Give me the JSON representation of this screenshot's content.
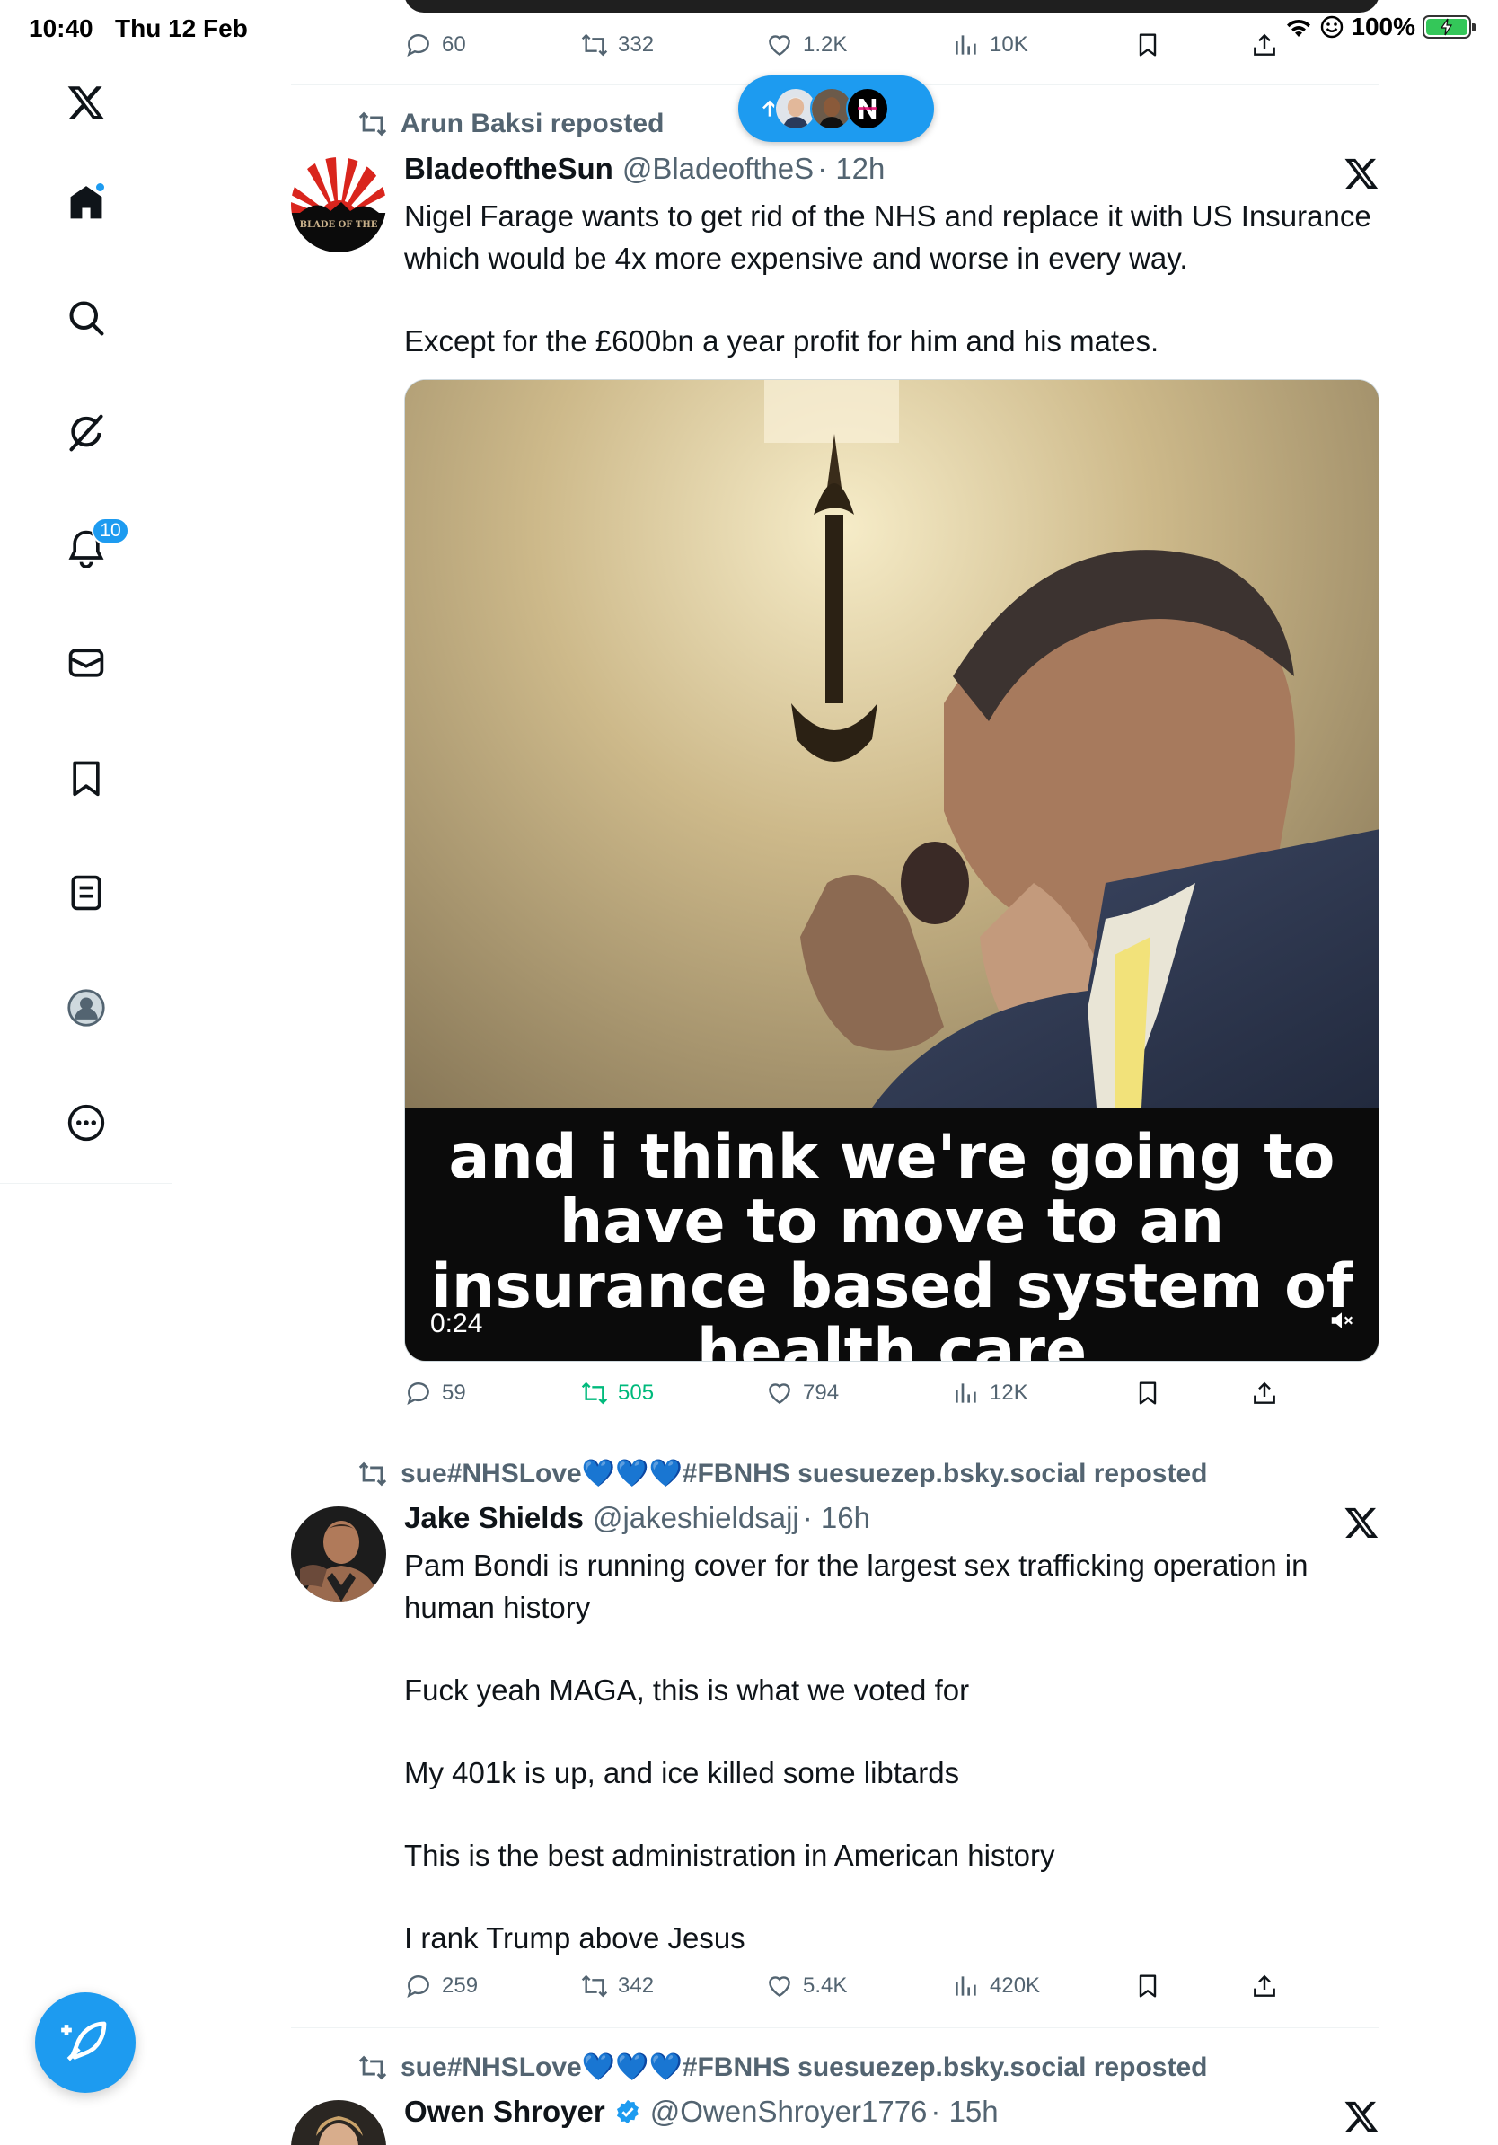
{
  "status_bar": {
    "time": "10:40",
    "date": "Thu 12 Feb",
    "battery": "100%"
  },
  "sidebar": {
    "items": [
      {
        "name": "home"
      },
      {
        "name": "explore"
      },
      {
        "name": "grok"
      },
      {
        "name": "notifications",
        "badge": "10"
      },
      {
        "name": "messages"
      },
      {
        "name": "bookmarks"
      },
      {
        "name": "lists"
      },
      {
        "name": "profile"
      },
      {
        "name": "more"
      }
    ]
  },
  "colors": {
    "accent": "#1d9bf0",
    "text": "#0f1419",
    "secondary": "#536471",
    "retweet_active": "#00ba7c"
  },
  "previous_tweet": {
    "replies": "60",
    "reposts": "332",
    "likes": "1.2K",
    "views": "10K"
  },
  "tweets": [
    {
      "reposted_by": "Arun Baksi reposted",
      "name": "BladeoftheSun",
      "handle": "@BladeoftheS",
      "time": "· 12h",
      "avatar_text": "BLADE OF THE",
      "text": [
        "Nigel Farage wants to get rid of the NHS and replace it with US Insurance which would be 4x more expensive and worse in every way.",
        "Except for the £600bn a year profit for him and his mates."
      ],
      "media": {
        "caption": "and i think we're going to have to move to an insurance based system of health care",
        "duration": "0:24"
      },
      "replies": "59",
      "reposts": "505",
      "likes": "794",
      "views": "12K"
    },
    {
      "reposted_by": "sue#NHSLove💙💙💙#FBNHS suesuezep.bsky.social reposted",
      "name": "Jake Shields",
      "handle": "@jakeshieldsajj",
      "time": "· 16h",
      "text": [
        "Pam Bondi is running cover for the largest sex trafficking operation in human history",
        "Fuck yeah MAGA, this is what we voted for",
        "My 401k is up, and ice killed some libtards",
        "This is the best administration in American history",
        "I rank Trump above Jesus"
      ],
      "replies": "259",
      "reposts": "342",
      "likes": "5.4K",
      "views": "420K"
    },
    {
      "reposted_by": "sue#NHSLove💙💙💙#FBNHS suesuezep.bsky.social reposted",
      "name": "Owen Shroyer",
      "handle": "@OwenShroyer1776",
      "time": "· 15h",
      "verified": true
    }
  ]
}
